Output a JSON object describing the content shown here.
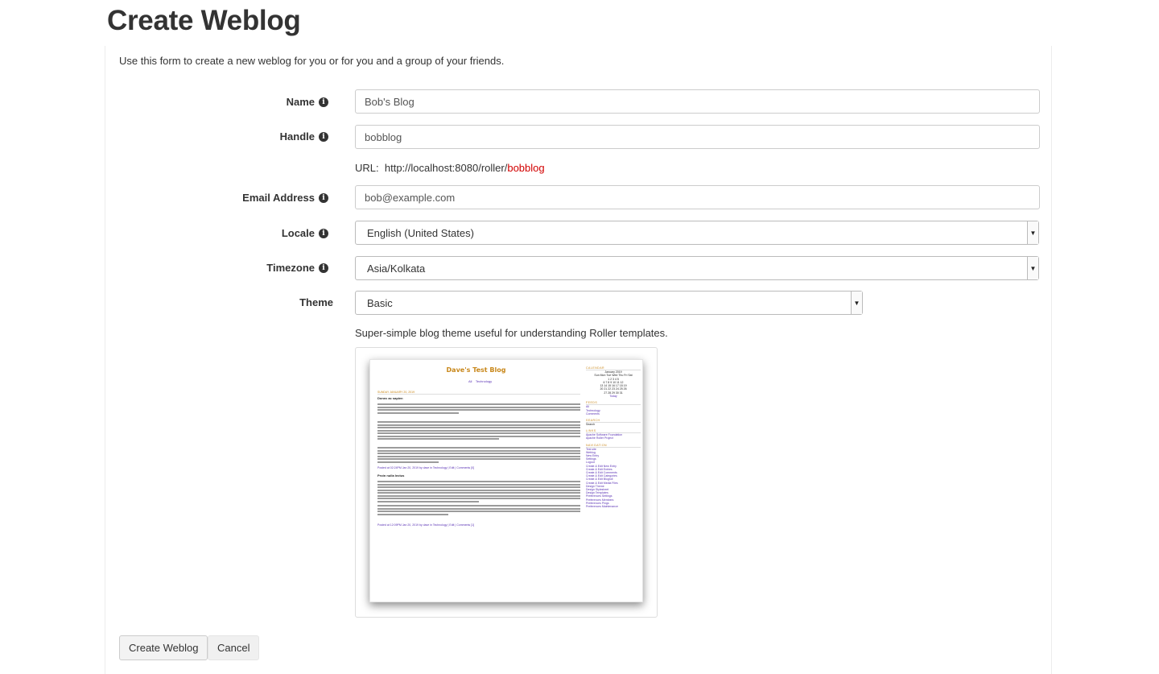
{
  "page": {
    "title": "Create Weblog",
    "intro": "Use this form to create a new weblog for you or for you and a group of your friends."
  },
  "form": {
    "name": {
      "label": "Name",
      "value": "Bob's Blog"
    },
    "handle": {
      "label": "Handle",
      "value": "bobblog"
    },
    "url": {
      "prefix": "URL:",
      "base": "http://localhost:8080/roller/",
      "handle": "bobblog"
    },
    "email": {
      "label": "Email Address",
      "value": "bob@example.com"
    },
    "locale": {
      "label": "Locale",
      "value": "English (United States)"
    },
    "timezone": {
      "label": "Timezone",
      "value": "Asia/Kolkata"
    },
    "theme": {
      "label": "Theme",
      "value": "Basic",
      "description": "Super-simple blog theme useful for understanding Roller templates."
    }
  },
  "preview": {
    "blog_title": "Dave's Test Blog",
    "nav": [
      "All",
      "Technology"
    ],
    "date": "SUNDAY JANUARY 20, 2019",
    "post1_title": "Donec ac sapien",
    "post1_meta": "Posted at 02:24PM Jan 20, 2019 by dave in Technology  |  Edit  |  Comments [0]",
    "post2_title": "Proin nulla lectus",
    "post2_meta": "Posted at 12:09PM Jan 20, 2019 by dave in Technology  |  Edit  |  Comments [1]",
    "sidebar": {
      "calendar_heading": "CALENDAR",
      "calendar_month": "January 2019",
      "calendar_days": "Sun Mon Tue Wed Thu Fri Sat",
      "calendar_rows": [
        "1 2 3 4 5",
        "6 7 8 9 10 11 12",
        "13 14 15 16 17 18 19",
        "20 21 22 23 24 25 26",
        "27 28 29 30 31"
      ],
      "today": "Today",
      "feeds_heading": "FEEDS",
      "feeds": [
        "All",
        "Technology",
        "Comments"
      ],
      "search_heading": "SEARCH",
      "search_button": "Search",
      "links_heading": "LINKS",
      "links": [
        "Apache Software Foundation",
        "Apache Roller Project"
      ],
      "navigation_heading": "NAVIGATION",
      "navigation": [
        "Test site",
        "Weblog",
        "New Entry",
        "Settings",
        "Logout",
        "Create & Edit New Entry",
        "Create & Edit Entries",
        "Create & Edit Comments",
        "Create & Edit Categories",
        "Create & Edit Blogroll",
        "Create & Edit Media Files",
        "Design Theme",
        "Design Stylesheet",
        "Design Templates",
        "Preferences Settings",
        "Preferences Members",
        "Preferences Pings",
        "Preferences Maintenance"
      ]
    }
  },
  "buttons": {
    "create": "Create Weblog",
    "cancel": "Cancel"
  },
  "icons": {
    "info": "info-circle-icon",
    "dropdown": "caret-down-icon"
  },
  "colors": {
    "url_handle": "#d20000",
    "preview_title": "#c8871a",
    "preview_link": "#5a32b5"
  }
}
